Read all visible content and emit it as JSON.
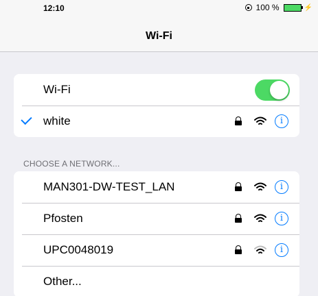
{
  "status_bar": {
    "time": "12:10",
    "battery_text": "100 %",
    "rotation_lock_icon": "rotation-lock-icon",
    "battery_icon": "battery-icon",
    "charging_icon": "charging-bolt-icon",
    "battery_color": "#4cd964"
  },
  "nav": {
    "title": "Wi-Fi"
  },
  "wifi_toggle": {
    "label": "Wi-Fi",
    "on": true,
    "color": "#4cd964"
  },
  "connected_network": {
    "name": "white",
    "checkmark_icon": "checkmark-icon",
    "secured": true,
    "signal_bars": 3
  },
  "choose_network": {
    "header": "CHOOSE A NETWORK...",
    "networks": [
      {
        "name": "MAN301-DW-TEST_LAN",
        "secured": true,
        "signal_bars": 3
      },
      {
        "name": "Pfosten",
        "secured": true,
        "signal_bars": 3
      },
      {
        "name": "UPC0048019",
        "secured": true,
        "signal_bars": 2
      }
    ],
    "other_label": "Other..."
  },
  "icons": {
    "lock": "lock-icon",
    "wifi": "wifi-signal-icon",
    "info": "info-icon",
    "info_glyph": "i"
  },
  "accent_color": "#007aff"
}
